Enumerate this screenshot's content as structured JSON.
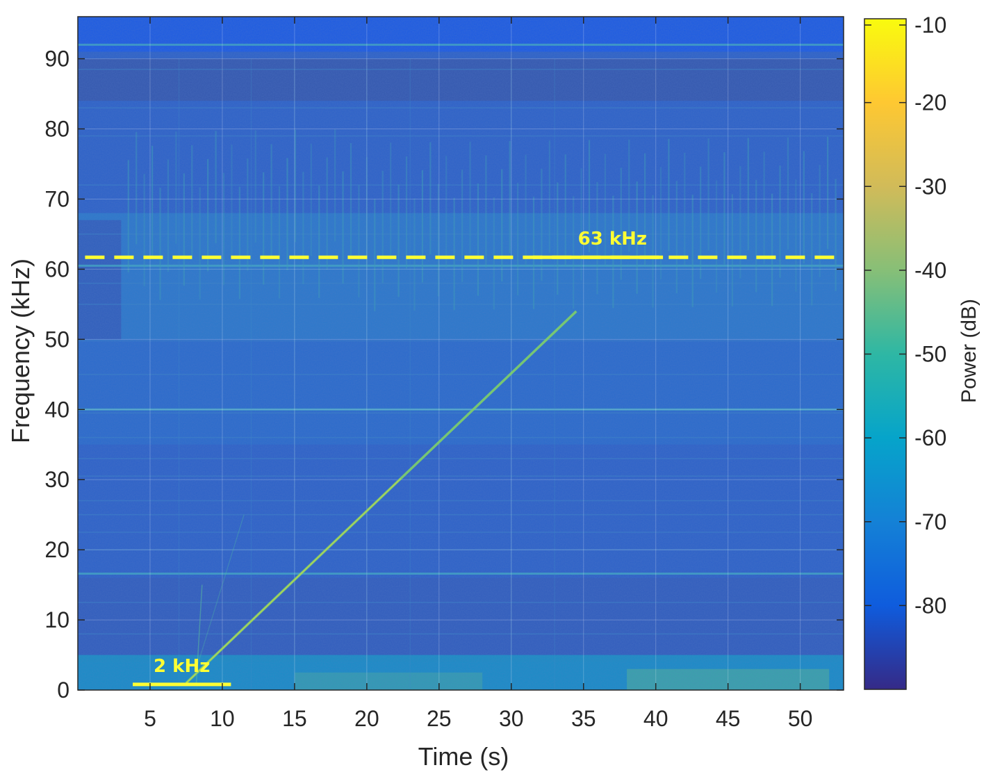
{
  "chart_data": {
    "type": "heatmap",
    "plot_kind": "spectrogram",
    "xlabel": "Time (s)",
    "ylabel": "Frequency (kHz)",
    "x_unit": "s",
    "y_unit": "kHz",
    "xlim": [
      0,
      53
    ],
    "ylim": [
      0,
      96
    ],
    "xticks": [
      5,
      10,
      15,
      20,
      25,
      30,
      35,
      40,
      45,
      50
    ],
    "yticks": [
      0,
      10,
      20,
      30,
      40,
      50,
      60,
      70,
      80,
      90
    ],
    "grid": true,
    "colormap": "parula",
    "colorbar": {
      "label": "Power (dB)",
      "range": [
        -90,
        -10
      ],
      "ticks": [
        -10,
        -20,
        -30,
        -40,
        -50,
        -60,
        -70,
        -80
      ],
      "placement": "right"
    },
    "chirp": {
      "description": "linear frequency sweep",
      "start": {
        "t": 7.5,
        "f": 1
      },
      "end": {
        "t": 34.5,
        "f": 54
      }
    },
    "annotations": [
      {
        "text": "63 kHz",
        "kind": "reference line",
        "y": 61.7,
        "x_range": [
          0.5,
          52.5
        ],
        "style": "dashed",
        "label_x": 37,
        "color": "#ffff33"
      },
      {
        "text": "2 kHz",
        "kind": "marker line",
        "y": 0.8,
        "x_range": [
          3.8,
          10.6
        ],
        "style": "solid",
        "label_x": 7.2,
        "color": "#ffff33"
      }
    ]
  }
}
